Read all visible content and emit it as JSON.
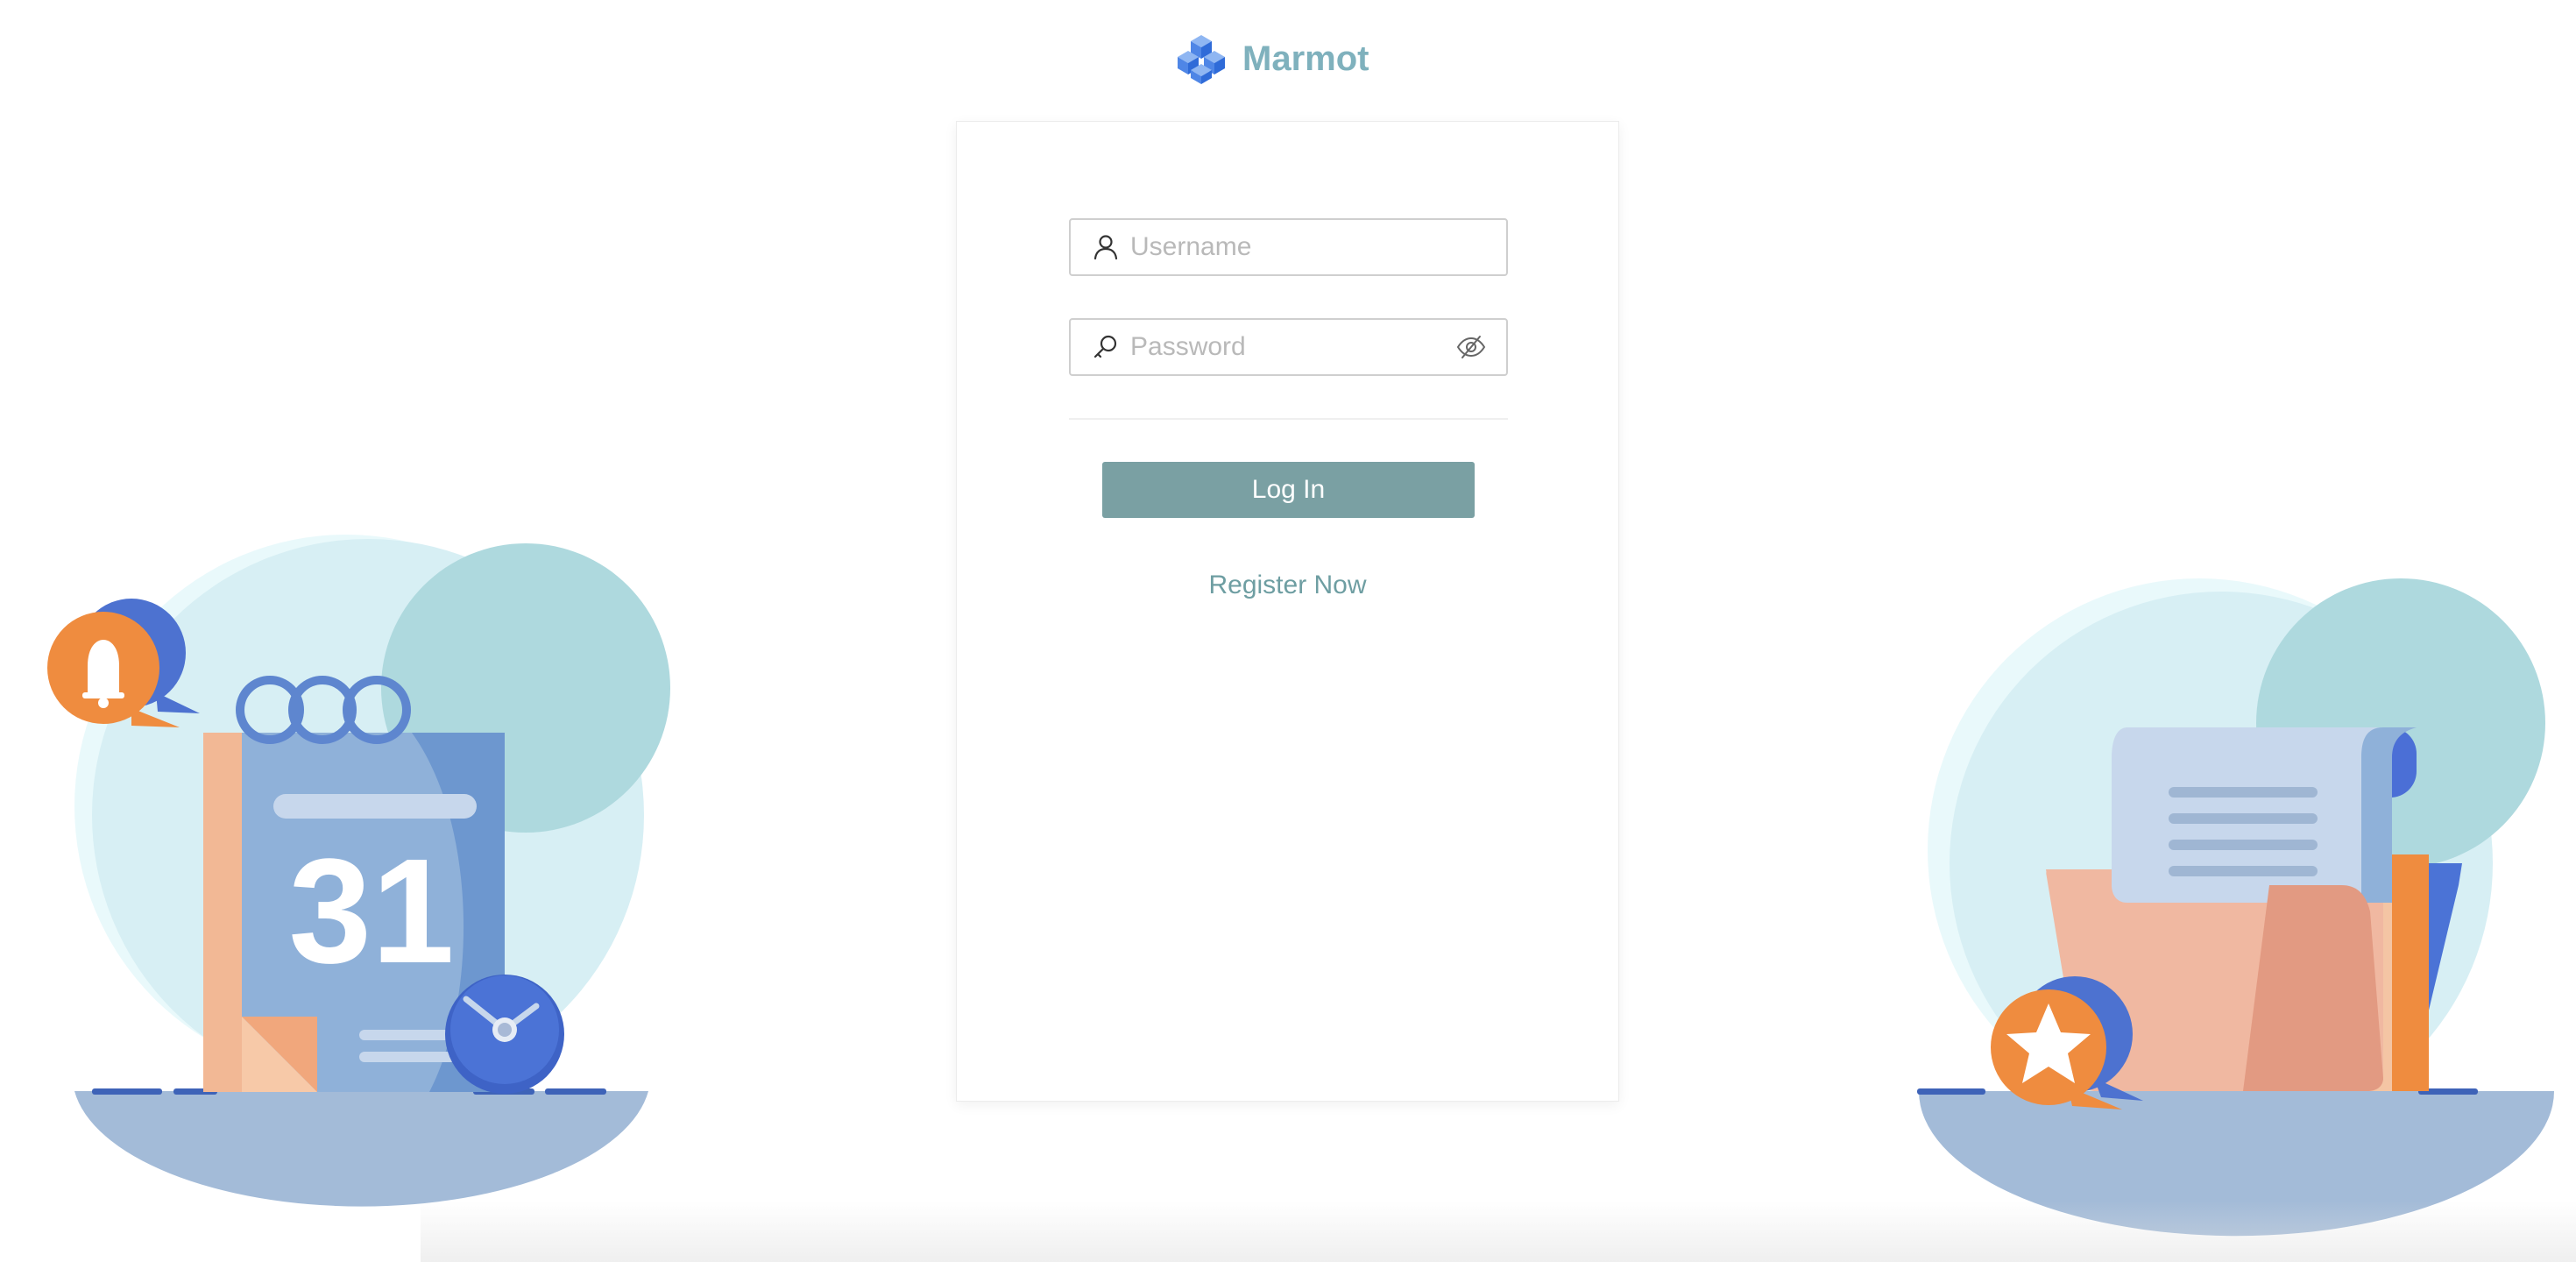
{
  "brand": {
    "name": "Marmot",
    "logo_icon": "cube-cluster-icon",
    "color": "#7fb1bd"
  },
  "login_form": {
    "username": {
      "placeholder": "Username",
      "value": "",
      "icon": "user-icon"
    },
    "password": {
      "placeholder": "Password",
      "value": "",
      "icon": "key-icon",
      "toggle_icon": "eye-hidden-icon"
    },
    "submit_label": "Log In",
    "register_label": "Register Now",
    "button_color": "#7aa0a3",
    "link_color": "#6e9ea2"
  },
  "illustrations": {
    "left": {
      "calendar_number": "31",
      "icons": [
        "bell-icon",
        "clock-icon",
        "calendar-icon"
      ]
    },
    "right": {
      "icons": [
        "folder-icon",
        "document-scroll-icon",
        "star-icon"
      ]
    }
  }
}
